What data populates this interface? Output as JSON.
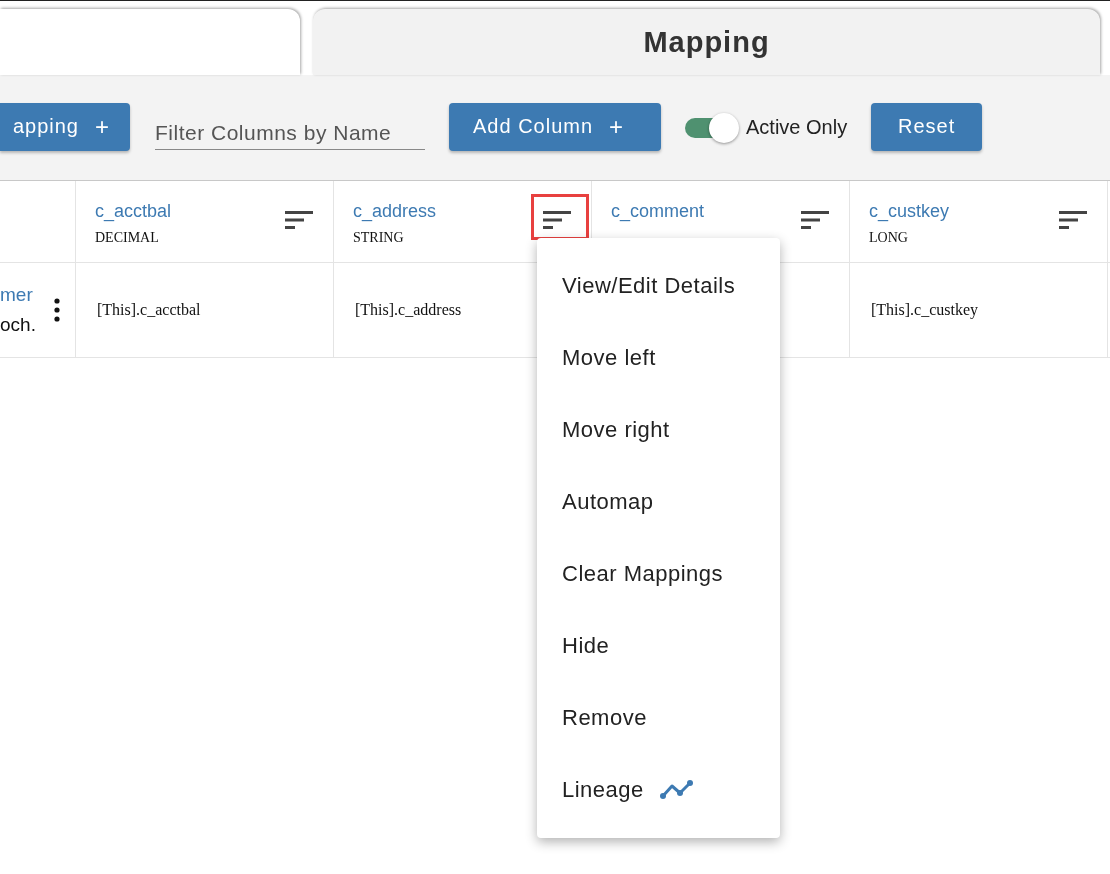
{
  "tabs": [
    {
      "selected": false
    },
    {
      "label": "Mapping",
      "selected": true
    }
  ],
  "toolbar": {
    "add_mapping_button": "apping",
    "add_mapping_icon": "+",
    "filter_field": {
      "placeholder": "Filter Columns by Name"
    },
    "add_column_button": "Add Column",
    "add_column_icon": "+",
    "active_only": {
      "label": "Active Only",
      "on": true
    },
    "reset_button": "Reset"
  },
  "table": {
    "first_column": {
      "name": "mer",
      "value": "och."
    },
    "columns": [
      {
        "name": "c_acctbal",
        "type": "DECIMAL",
        "value": "[This].c_acctbal",
        "highlighted": false
      },
      {
        "name": "c_address",
        "type": "STRING",
        "value": "[This].c_address",
        "highlighted": true
      },
      {
        "name": "c_comment",
        "highlighted": false
      },
      {
        "name": "c_custkey",
        "type": "LONG",
        "value": "[This].c_custkey",
        "highlighted": false
      }
    ]
  },
  "column_menu": {
    "items": [
      {
        "label": "View/Edit Details"
      },
      {
        "label": "Move left"
      },
      {
        "label": "Move right"
      },
      {
        "label": "Automap"
      },
      {
        "label": "Clear Mappings"
      },
      {
        "label": "Hide"
      },
      {
        "label": "Remove"
      },
      {
        "label": "Lineage",
        "kind": "lineage"
      }
    ]
  }
}
